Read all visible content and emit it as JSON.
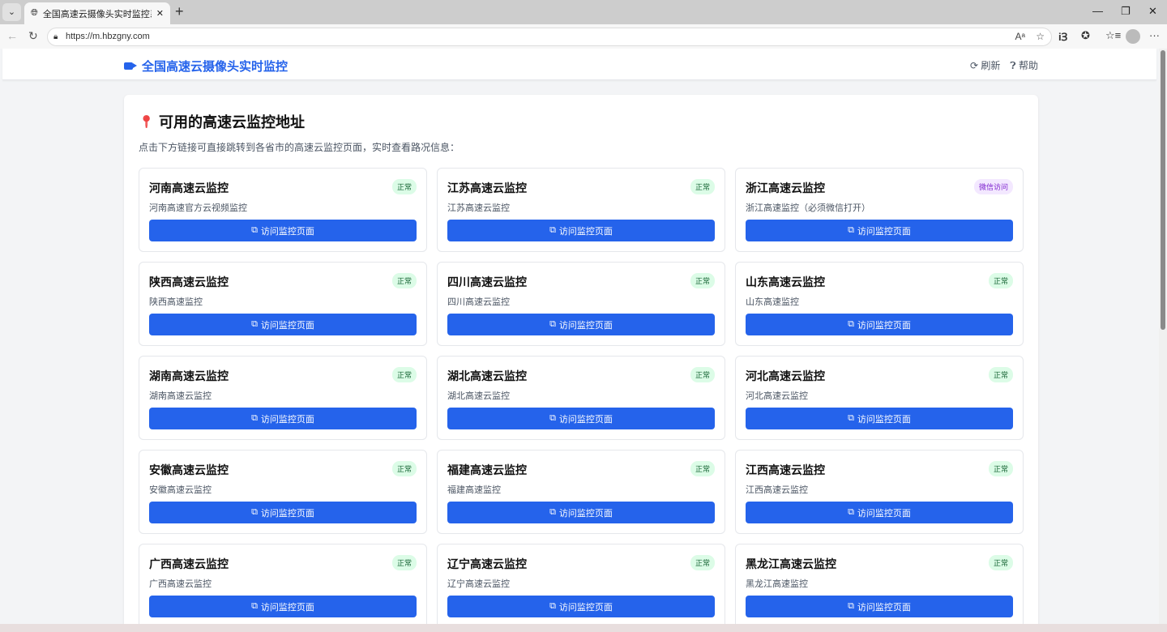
{
  "browser": {
    "tab_title": "全国高速云摄像头实时监控系统",
    "url": "https://m.hbzgny.com"
  },
  "header": {
    "logo": "全国高速云摄像头实时监控",
    "refresh": "刷新",
    "help": "帮助"
  },
  "main": {
    "title": "可用的高速云监控地址",
    "description": "点击下方链接可直接跳转到各省市的高速云监控页面，实时查看路况信息：",
    "button_label": "访问监控页面",
    "cards": [
      {
        "name": "河南高速云监控",
        "desc": "河南高速官方云视频监控",
        "badge": "正常",
        "type": "ok"
      },
      {
        "name": "江苏高速云监控",
        "desc": "江苏高速云监控",
        "badge": "正常",
        "type": "ok"
      },
      {
        "name": "浙江高速云监控",
        "desc": "浙江高速监控（必须微信打开）",
        "badge": "微信访问",
        "type": "wx"
      },
      {
        "name": "陕西高速云监控",
        "desc": "陕西高速监控",
        "badge": "正常",
        "type": "ok"
      },
      {
        "name": "四川高速云监控",
        "desc": "四川高速云监控",
        "badge": "正常",
        "type": "ok"
      },
      {
        "name": "山东高速云监控",
        "desc": "山东高速监控",
        "badge": "正常",
        "type": "ok"
      },
      {
        "name": "湖南高速云监控",
        "desc": "湖南高速云监控",
        "badge": "正常",
        "type": "ok"
      },
      {
        "name": "湖北高速云监控",
        "desc": "湖北高速云监控",
        "badge": "正常",
        "type": "ok"
      },
      {
        "name": "河北高速云监控",
        "desc": "河北高速云监控",
        "badge": "正常",
        "type": "ok"
      },
      {
        "name": "安徽高速云监控",
        "desc": "安徽高速云监控",
        "badge": "正常",
        "type": "ok"
      },
      {
        "name": "福建高速云监控",
        "desc": "福建高速监控",
        "badge": "正常",
        "type": "ok"
      },
      {
        "name": "江西高速云监控",
        "desc": "江西高速云监控",
        "badge": "正常",
        "type": "ok"
      },
      {
        "name": "广西高速云监控",
        "desc": "广西高速云监控",
        "badge": "正常",
        "type": "ok"
      },
      {
        "name": "辽宁高速云监控",
        "desc": "辽宁高速云监控",
        "badge": "正常",
        "type": "ok"
      },
      {
        "name": "黑龙江高速云监控",
        "desc": "黑龙江高速监控",
        "badge": "正常",
        "type": "ok"
      }
    ]
  },
  "colors": {
    "accent": "#2563eb",
    "ok_bg": "#dcfce7",
    "wx_bg": "#f3e8ff"
  }
}
